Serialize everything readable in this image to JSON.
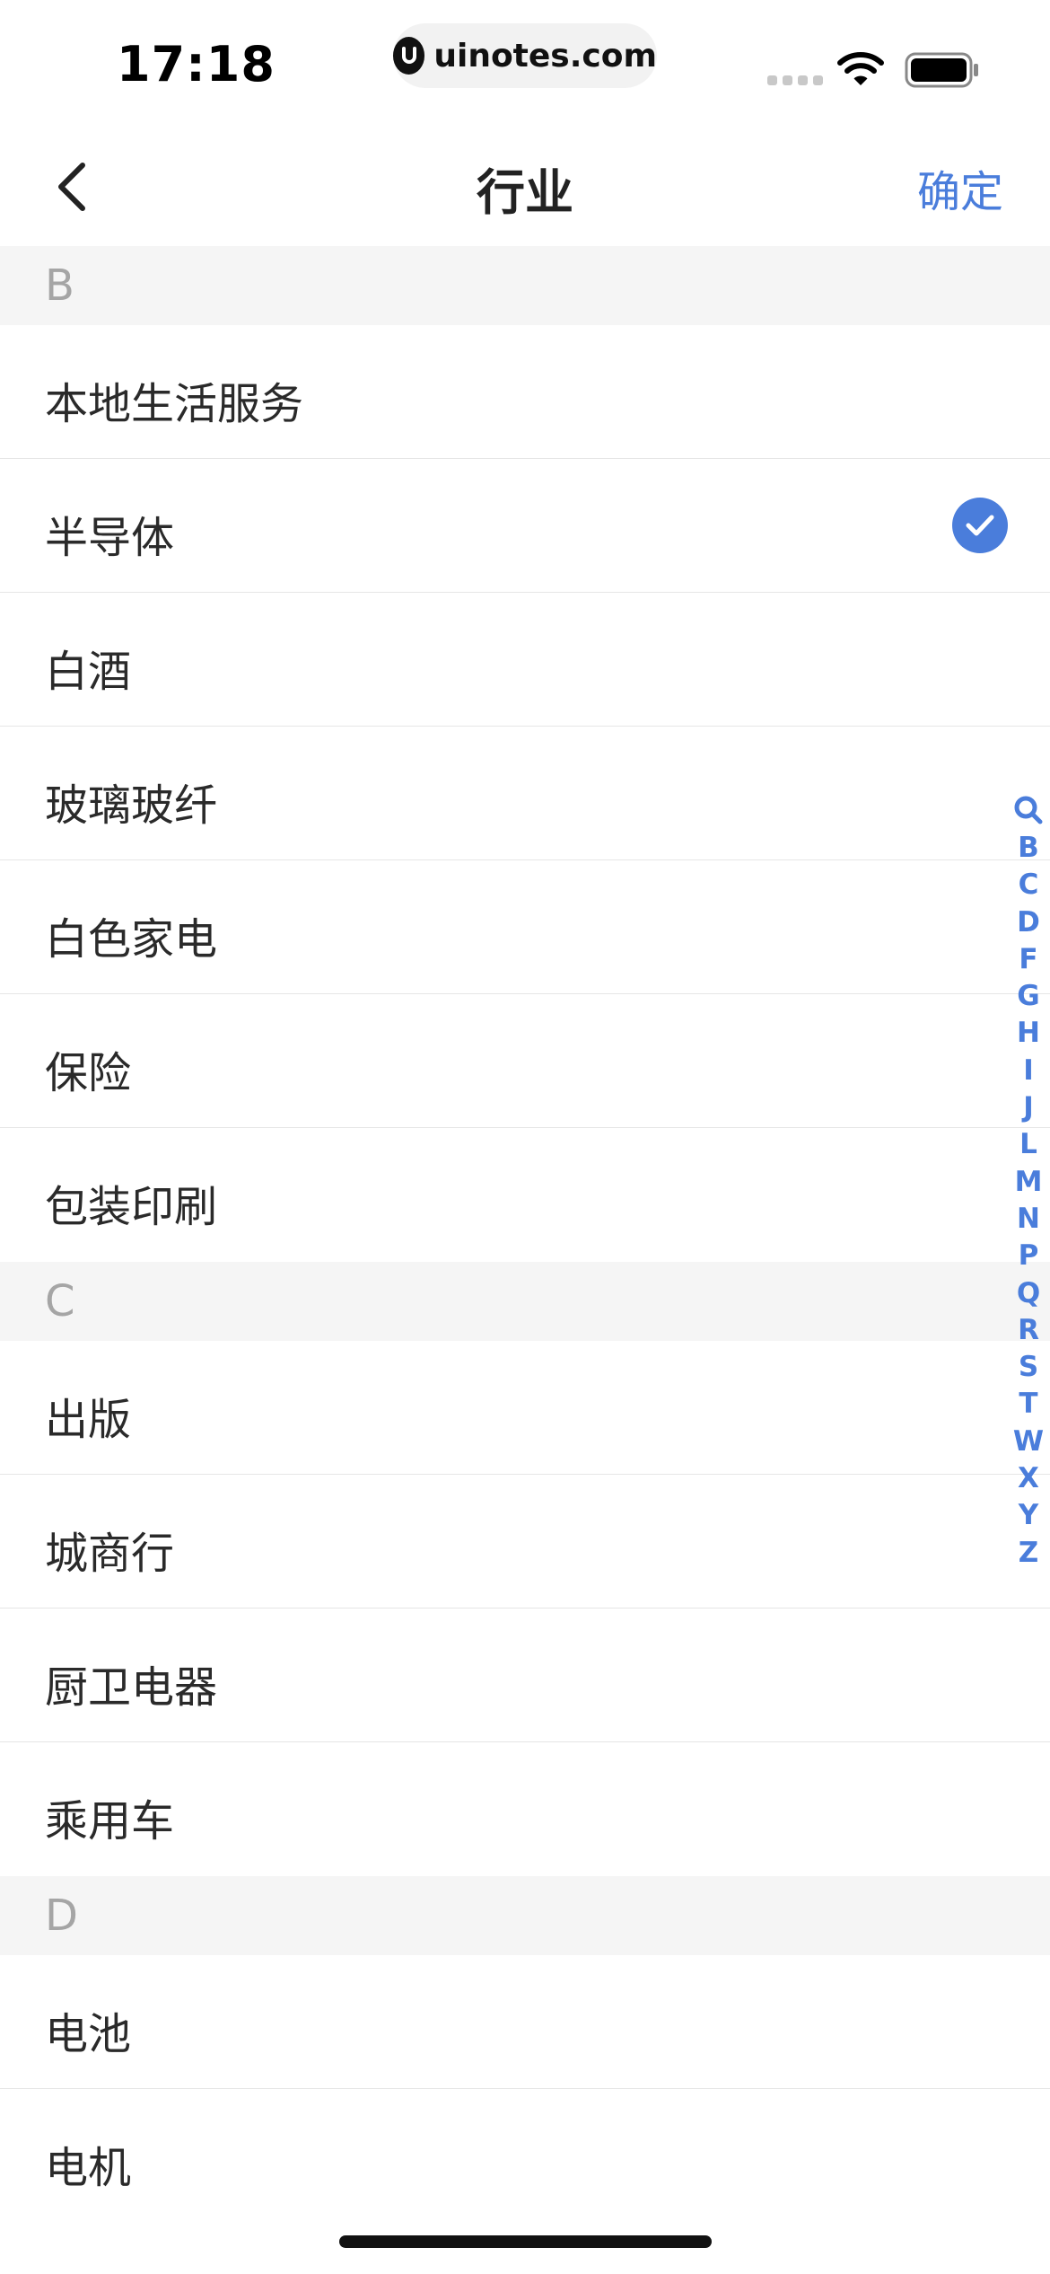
{
  "status_bar": {
    "time": "17:18",
    "url": "uinotes.com"
  },
  "nav": {
    "title": "行业",
    "confirm_label": "确定"
  },
  "sections": [
    {
      "letter": "B",
      "items": [
        {
          "label": "本地生活服务",
          "selected": false
        },
        {
          "label": "半导体",
          "selected": true
        },
        {
          "label": "白酒",
          "selected": false
        },
        {
          "label": "玻璃玻纤",
          "selected": false
        },
        {
          "label": "白色家电",
          "selected": false
        },
        {
          "label": "保险",
          "selected": false
        },
        {
          "label": "包装印刷",
          "selected": false
        }
      ]
    },
    {
      "letter": "C",
      "items": [
        {
          "label": "出版",
          "selected": false
        },
        {
          "label": "城商行",
          "selected": false
        },
        {
          "label": "厨卫电器",
          "selected": false
        },
        {
          "label": "乘用车",
          "selected": false
        }
      ]
    },
    {
      "letter": "D",
      "items": [
        {
          "label": "电池",
          "selected": false
        },
        {
          "label": "电机",
          "selected": false
        }
      ]
    }
  ],
  "index_bar": {
    "search_icon": "search-icon",
    "letters": [
      "B",
      "C",
      "D",
      "F",
      "G",
      "H",
      "I",
      "J",
      "L",
      "M",
      "N",
      "P",
      "Q",
      "R",
      "S",
      "T",
      "W",
      "X",
      "Y",
      "Z"
    ]
  },
  "colors": {
    "accent": "#4a7ddb",
    "section_bg": "#f5f5f5",
    "section_letter": "#a5a5a5",
    "divider": "#e6e6e6"
  }
}
